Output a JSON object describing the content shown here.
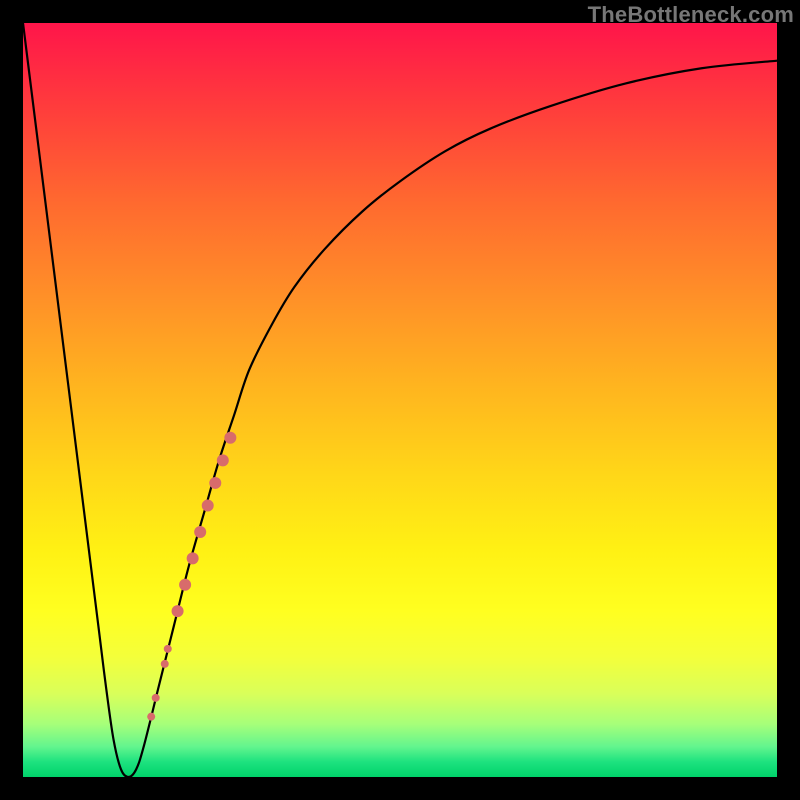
{
  "watermark": "TheBottleneck.com",
  "colors": {
    "frame": "#000000",
    "curve": "#000000",
    "marker": "#d86b6b",
    "gradient_top": "#ff154a",
    "gradient_bottom": "#00d26a"
  },
  "chart_data": {
    "type": "line",
    "title": "",
    "xlabel": "",
    "ylabel": "",
    "xlim": [
      0,
      100
    ],
    "ylim": [
      0,
      100
    ],
    "x": [
      0,
      2,
      4,
      6,
      8,
      10,
      11,
      12,
      13,
      14,
      15,
      16,
      18,
      20,
      22,
      24,
      26,
      28,
      30,
      33,
      36,
      40,
      45,
      50,
      56,
      62,
      70,
      80,
      90,
      100
    ],
    "y": [
      100,
      84,
      68,
      52,
      36,
      20,
      12,
      5,
      1,
      0,
      1,
      4,
      12,
      20,
      28,
      35,
      42,
      48,
      54,
      60,
      65,
      70,
      75,
      79,
      83,
      86,
      89,
      92,
      94,
      95
    ],
    "series": [
      {
        "name": "curve",
        "type": "line",
        "color": "#000000"
      },
      {
        "name": "marked-segment",
        "type": "scatter",
        "color": "#d86b6b",
        "points": [
          {
            "x": 17.0,
            "y": 8.0,
            "r": 4
          },
          {
            "x": 17.6,
            "y": 10.5,
            "r": 4
          },
          {
            "x": 18.8,
            "y": 15.0,
            "r": 4
          },
          {
            "x": 19.2,
            "y": 17.0,
            "r": 4
          },
          {
            "x": 20.5,
            "y": 22.0,
            "r": 6
          },
          {
            "x": 21.5,
            "y": 25.5,
            "r": 6
          },
          {
            "x": 22.5,
            "y": 29.0,
            "r": 6
          },
          {
            "x": 23.5,
            "y": 32.5,
            "r": 6
          },
          {
            "x": 24.5,
            "y": 36.0,
            "r": 6
          },
          {
            "x": 25.5,
            "y": 39.0,
            "r": 6
          },
          {
            "x": 26.5,
            "y": 42.0,
            "r": 6
          },
          {
            "x": 27.5,
            "y": 45.0,
            "r": 6
          }
        ]
      }
    ],
    "annotations": []
  }
}
